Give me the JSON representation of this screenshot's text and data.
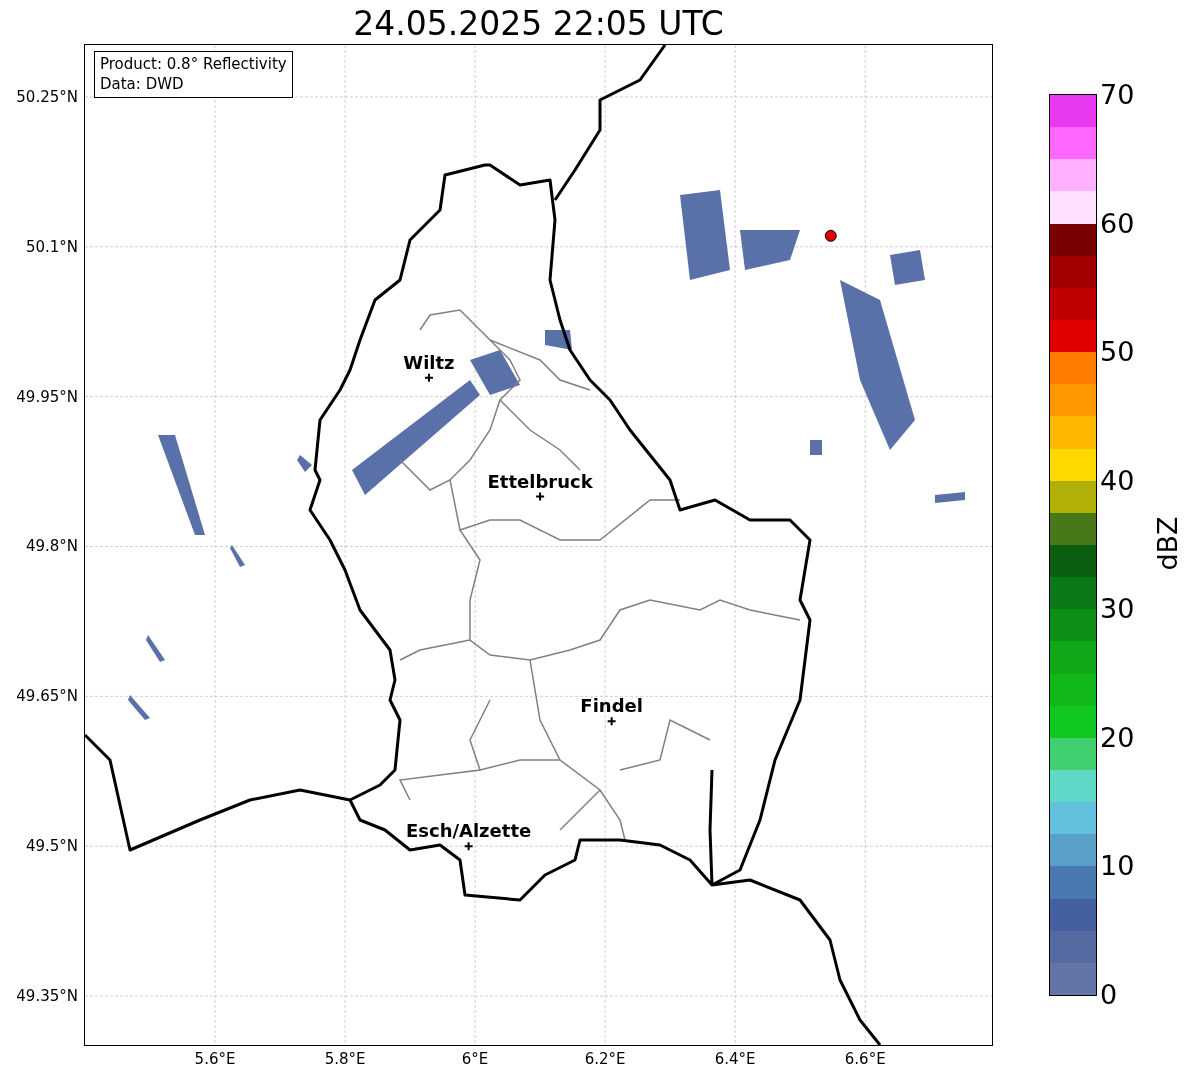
{
  "map": {
    "info_box": [
      "Product: 0.8° Reflectivity",
      "Data: DWD"
    ],
    "chart_data": {
      "type": "scatter",
      "grid": true,
      "title": "24.05.2025 22:05 UTC",
      "xlim": [
        5.4,
        6.795
      ],
      "ylim": [
        49.301,
        50.302
      ],
      "xticks": [
        {
          "value": 5.6,
          "label": "5.6°E"
        },
        {
          "value": 5.8,
          "label": "5.8°E"
        },
        {
          "value": 6.0,
          "label": "6°E"
        },
        {
          "value": 6.2,
          "label": "6.2°E"
        },
        {
          "value": 6.4,
          "label": "6.4°E"
        },
        {
          "value": 6.6,
          "label": "6.6°E"
        }
      ],
      "yticks": [
        {
          "value": 50.25,
          "label": "50.25°N"
        },
        {
          "value": 50.1,
          "label": "50.1°N"
        },
        {
          "value": 49.95,
          "label": "49.95°N"
        },
        {
          "value": 49.8,
          "label": "49.8°N"
        },
        {
          "value": 49.65,
          "label": "49.65°N"
        },
        {
          "value": 49.5,
          "label": "49.5°N"
        },
        {
          "value": 49.35,
          "label": "49.35°N"
        }
      ],
      "series": [
        {
          "color": "#000000",
          "x": [
            5.929,
            6.1,
            6.21,
            5.99
          ],
          "values": [
            49.969,
            49.85,
            49.625,
            49.5
          ]
        },
        {
          "color": "#e00000",
          "x": [
            6.547
          ],
          "values": [
            50.111
          ]
        }
      ],
      "annotations": [
        {
          "text": "Wiltz",
          "x": 5.929,
          "y": 49.969
        },
        {
          "text": "Ettelbruck",
          "x": 6.1,
          "y": 49.85
        },
        {
          "text": "Findel",
          "x": 6.21,
          "y": 49.625
        },
        {
          "text": "Esch/Alzette",
          "x": 5.99,
          "y": 49.5
        }
      ]
    }
  },
  "colorbar": {
    "label": "dBZ",
    "ticks": [
      "70",
      "60",
      "50",
      "40",
      "30",
      "20",
      "10",
      "0"
    ],
    "bins": [
      {
        "color": "#6375a6"
      },
      {
        "color": "#546aa0"
      },
      {
        "color": "#4460a0"
      },
      {
        "color": "#4a78b0"
      },
      {
        "color": "#58a0c8"
      },
      {
        "color": "#62c0dc"
      },
      {
        "color": "#60d8c8"
      },
      {
        "color": "#40d070"
      },
      {
        "color": "#10c820"
      },
      {
        "color": "#10b818"
      },
      {
        "color": "#10a818"
      },
      {
        "color": "#0e9018"
      },
      {
        "color": "#0a7818"
      },
      {
        "color": "#0a6010"
      },
      {
        "color": "#487818"
      },
      {
        "color": "#b0b008"
      },
      {
        "color": "#ffd800"
      },
      {
        "color": "#ffb800"
      },
      {
        "color": "#ff9800"
      },
      {
        "color": "#ff7c00"
      },
      {
        "color": "#e00000"
      },
      {
        "color": "#c00000"
      },
      {
        "color": "#a00000"
      },
      {
        "color": "#780000"
      },
      {
        "color": "#ffe0ff"
      },
      {
        "color": "#ffb0ff"
      },
      {
        "color": "#ff68ff"
      },
      {
        "color": "#e838f0"
      }
    ]
  }
}
